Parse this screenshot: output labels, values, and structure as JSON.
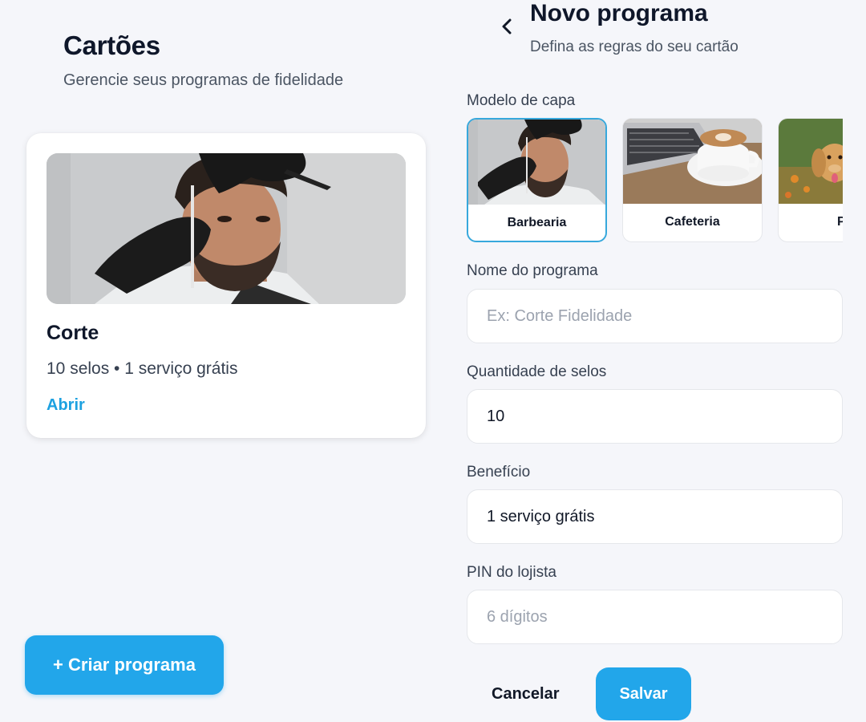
{
  "list_screen": {
    "title": "Cartões",
    "subtitle": "Gerencie seus programas de fidelidade",
    "cards": [
      {
        "cover": "barbershop-photo",
        "name": "Corte",
        "meta": "10 selos • 1 serviço grátis",
        "open_label": "Abrir"
      }
    ],
    "create_button_label": "+ Criar programa"
  },
  "form_screen": {
    "back_icon": "chevron-left-icon",
    "title": "Novo programa",
    "subtitle": "Defina as regras do seu cartão",
    "cover_section_label": "Modelo de capa",
    "cover_options": [
      {
        "label": "Barbearia",
        "image": "barbershop-photo",
        "selected": true
      },
      {
        "label": "Cafeteria",
        "image": "coffee-laptop-photo",
        "selected": false
      },
      {
        "label": "P",
        "image": "puppy-photo",
        "selected": false
      }
    ],
    "program_name": {
      "label": "Nome do programa",
      "value": "",
      "placeholder": "Ex: Corte Fidelidade"
    },
    "stamp_count": {
      "label": "Quantidade de selos",
      "value": "10",
      "placeholder": ""
    },
    "benefit": {
      "label": "Benefício",
      "value": "1 serviço grátis",
      "placeholder": ""
    },
    "pin": {
      "label": "PIN do lojista",
      "value": "",
      "placeholder": "6 dígitos"
    },
    "cancel_label": "Cancelar",
    "save_label": "Salvar"
  },
  "colors": {
    "background": "#f5f6fa",
    "accent": "#22a6ea",
    "link": "#1da1e0",
    "selected_border": "#37a8dc"
  }
}
